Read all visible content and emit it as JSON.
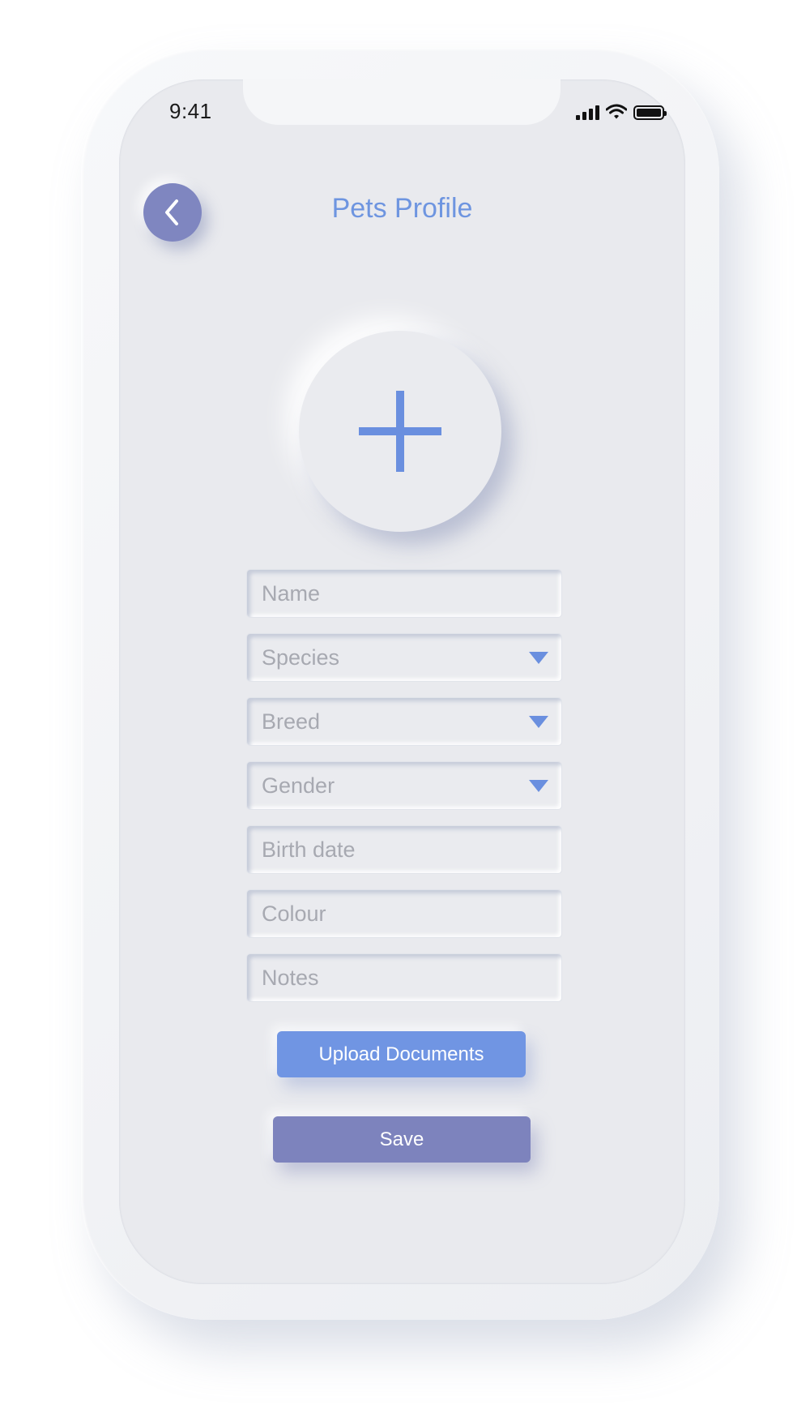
{
  "status_bar": {
    "time": "9:41",
    "icons": [
      "signal-icon",
      "wifi-icon",
      "battery-icon"
    ]
  },
  "header": {
    "back_icon": "chevron-left-icon",
    "title": "Pets Profile"
  },
  "avatar": {
    "icon": "plus-icon"
  },
  "form": {
    "name": {
      "placeholder": "Name"
    },
    "species": {
      "placeholder": "Species",
      "icon": "dropdown-arrow-icon"
    },
    "breed": {
      "placeholder": "Breed",
      "icon": "dropdown-arrow-icon"
    },
    "gender": {
      "placeholder": "Gender",
      "icon": "dropdown-arrow-icon"
    },
    "birth_date": {
      "placeholder": "Birth date"
    },
    "colour": {
      "placeholder": "Colour"
    },
    "notes": {
      "placeholder": "Notes"
    }
  },
  "actions": {
    "upload_label": "Upload Documents",
    "save_label": "Save"
  },
  "colors": {
    "accent_blue": "#7095e3",
    "accent_purple": "#7d83bd",
    "background": "#e9eaee",
    "title": "#6e95e0"
  }
}
